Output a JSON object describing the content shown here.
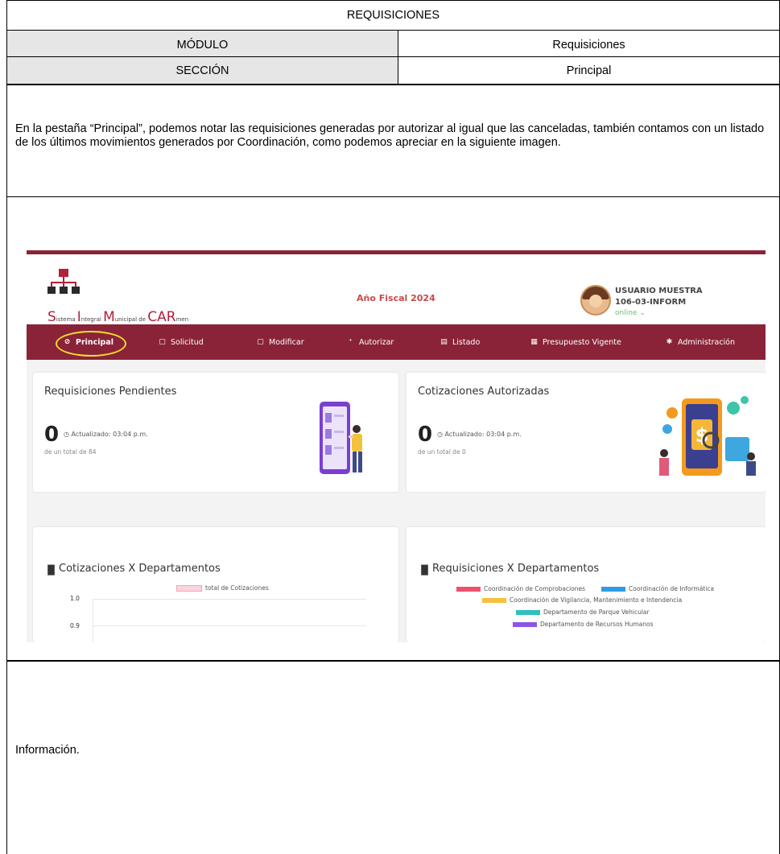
{
  "header": {
    "title": "REQUISICIONES",
    "modulo_label": "MÓDULO",
    "modulo_value": "Requisiciones",
    "seccion_label": "SECCIÓN",
    "seccion_value": "Principal"
  },
  "description": "En la pestaña “Principal”, podemos notar las requisiciones generadas por autorizar al igual que las canceladas, también contamos con un listado de los últimos movimientos generados por Coordinación, como podemos apreciar en la siguiente imagen.",
  "app": {
    "logo": {
      "s": "S",
      "s_rest": "istema ",
      "i": "I",
      "i_rest": "ntegral ",
      "m": "M",
      "m_rest": "unicipal de ",
      "car": "CAR",
      "car_rest": "men"
    },
    "fiscal_year": "Año Fiscal 2024",
    "user": {
      "name": "USUARIO MUESTRA",
      "code": "106-03-INFORM",
      "status": "online ⌄"
    },
    "nav": [
      {
        "label": "Principal",
        "icon": "clock-icon"
      },
      {
        "label": "Solicitud",
        "icon": "document-icon"
      },
      {
        "label": "Modificar",
        "icon": "document-icon"
      },
      {
        "label": "Autorizar",
        "icon": "user-plus-icon"
      },
      {
        "label": "Listado",
        "icon": "list-icon"
      },
      {
        "label": "Presupuesto Vigente",
        "icon": "table-icon"
      },
      {
        "label": "Administración",
        "icon": "gear-icon"
      }
    ],
    "cards": {
      "pendientes": {
        "title": "Requisiciones Pendientes",
        "count": "0",
        "updated": "Actualizado: 03:04 p.m.",
        "total": "de un total de 84"
      },
      "cotizaciones": {
        "title": "Cotizaciones Autorizadas",
        "count": "0",
        "updated": "Actualizado: 03:04 p.m.",
        "total": "de un total de 0"
      },
      "chart_cot": {
        "title": "Cotizaciones X Departamentos"
      },
      "chart_req": {
        "title": "Requisiciones X Departamentos"
      }
    },
    "colors": {
      "brand": "#8a2338",
      "highlight": "#f2dd2f"
    }
  },
  "chart_data": [
    {
      "type": "bar",
      "title": "Cotizaciones X Departamentos",
      "series": [
        {
          "name": "total de Cotizaciones",
          "color": "#f4b6c2"
        }
      ],
      "yticks": [
        "1.0",
        "0.9"
      ]
    },
    {
      "type": "bar",
      "title": "Requisiciones X Departamentos",
      "series": [
        {
          "name": "Coordinación de Comprobaciones",
          "color": "#f0506e"
        },
        {
          "name": "Coordinación de Informática",
          "color": "#2e9be6"
        },
        {
          "name": "Coordinación de Vigilancia, Mantenimiento e Intendencia",
          "color": "#f6c13a"
        },
        {
          "name": "Departamento de Parque Vehicular",
          "color": "#2ebfbf"
        },
        {
          "name": "Departamento de Recursos Humanos",
          "color": "#8c55e8"
        }
      ]
    }
  ],
  "footer": {
    "info": "Información."
  }
}
